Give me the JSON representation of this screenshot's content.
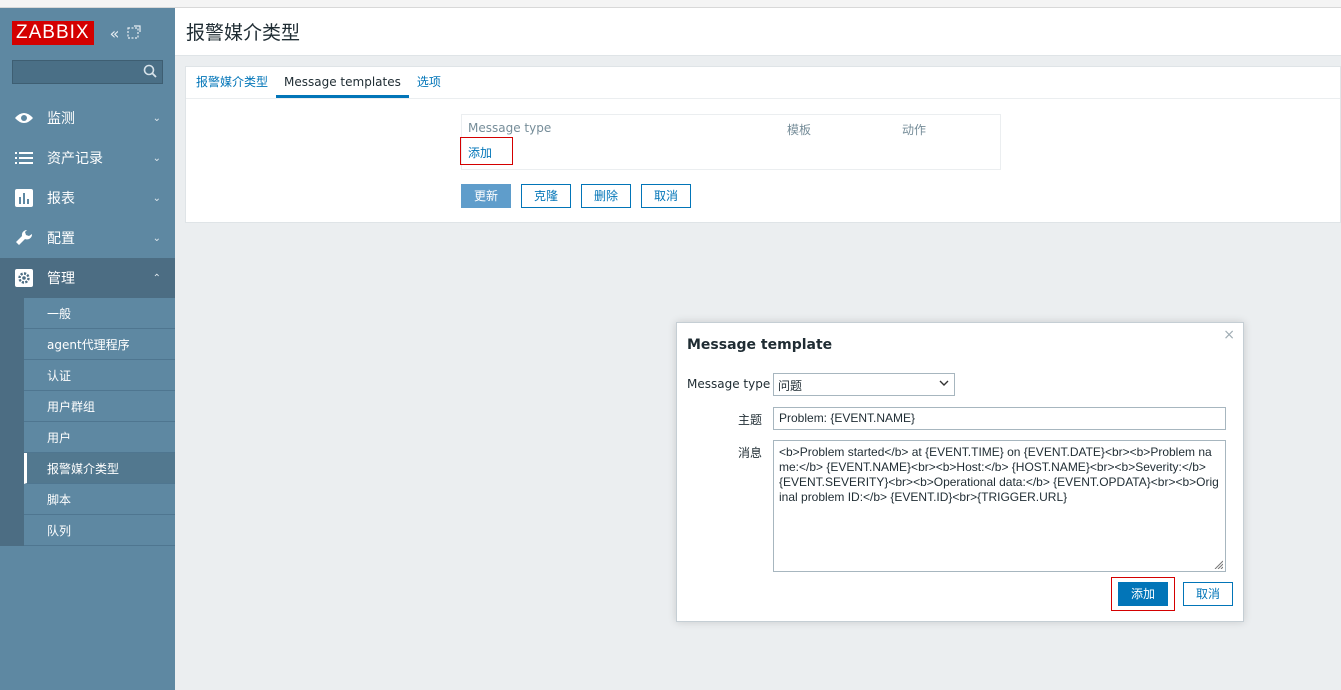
{
  "logo": "ZABBIX",
  "search": {
    "placeholder": ""
  },
  "nav": [
    {
      "label": "监测",
      "icon": "eye-icon"
    },
    {
      "label": "资产记录",
      "icon": "list-icon"
    },
    {
      "label": "报表",
      "icon": "bar-chart-icon"
    },
    {
      "label": "配置",
      "icon": "wrench-icon"
    },
    {
      "label": "管理",
      "icon": "gear-icon"
    }
  ],
  "admin_sub": [
    "一般",
    "agent代理程序",
    "认证",
    "用户群组",
    "用户",
    "报警媒介类型",
    "脚本",
    "队列"
  ],
  "page": {
    "title": "报警媒介类型"
  },
  "tabs": [
    "报警媒介类型",
    "Message templates",
    "选项"
  ],
  "templates_table": {
    "headers": [
      "Message type",
      "模板",
      "动作"
    ],
    "add_link": "添加"
  },
  "buttons": {
    "update": "更新",
    "clone": "克隆",
    "delete": "删除",
    "cancel": "取消"
  },
  "modal": {
    "title": "Message template",
    "type_label": "Message type",
    "type_value": "问题",
    "subject_label": "主题",
    "subject_value": "Problem: {EVENT.NAME}",
    "message_label": "消息",
    "message_value": "<b>Problem started</b> at {EVENT.TIME} on {EVENT.DATE}<br><b>Problem name:</b> {EVENT.NAME}<br><b>Host:</b> {HOST.NAME}<br><b>Severity:</b> {EVENT.SEVERITY}<br><b>Operational data:</b> {EVENT.OPDATA}<br><b>Original problem ID:</b> {EVENT.ID}<br>{TRIGGER.URL}",
    "add_button": "添加",
    "cancel_button": "取消",
    "close": "×"
  },
  "colors": {
    "sidebar": "#5e88a2",
    "accent": "#0275b8",
    "highlight": "#d40000"
  }
}
